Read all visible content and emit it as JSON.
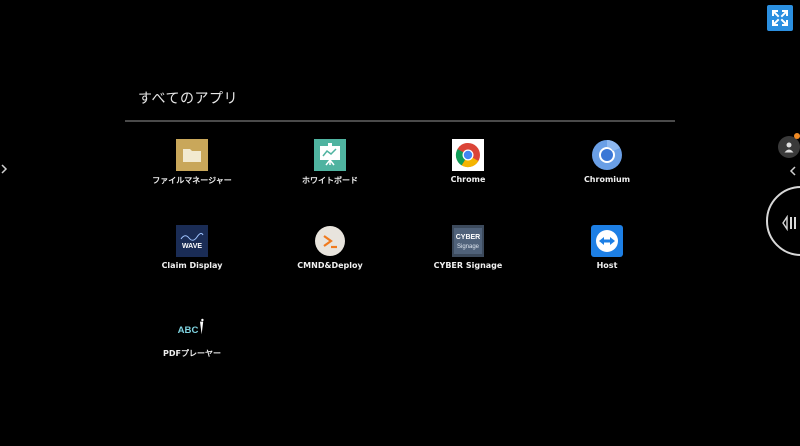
{
  "section": {
    "title": "すべてのアプリ"
  },
  "apps": [
    {
      "label": "ファイルマネージャー",
      "icon": "folder-icon"
    },
    {
      "label": "ホワイトボード",
      "icon": "whiteboard-icon"
    },
    {
      "label": "Chrome",
      "icon": "chrome-icon"
    },
    {
      "label": "Chromium",
      "icon": "chromium-icon"
    },
    {
      "label": "Claim Display",
      "icon": "claim-display-icon",
      "icon_text": "WAVE"
    },
    {
      "label": "CMND&Deploy",
      "icon": "cmnd-deploy-icon"
    },
    {
      "label": "CYBER Signage",
      "icon": "cyber-signage-icon",
      "icon_text": "CYBER Signage"
    },
    {
      "label": "Host",
      "icon": "host-icon"
    },
    {
      "label": "PDFプレーヤー",
      "icon": "pdf-player-icon",
      "icon_text": "ABC"
    }
  ],
  "controls": {
    "left_arrow": "‹",
    "right_arrow": "‹"
  },
  "colors": {
    "background": "#000000",
    "accent_blue": "#2b8fe0",
    "divider": "#4a4a4a",
    "badge_orange": "#f08a24"
  }
}
